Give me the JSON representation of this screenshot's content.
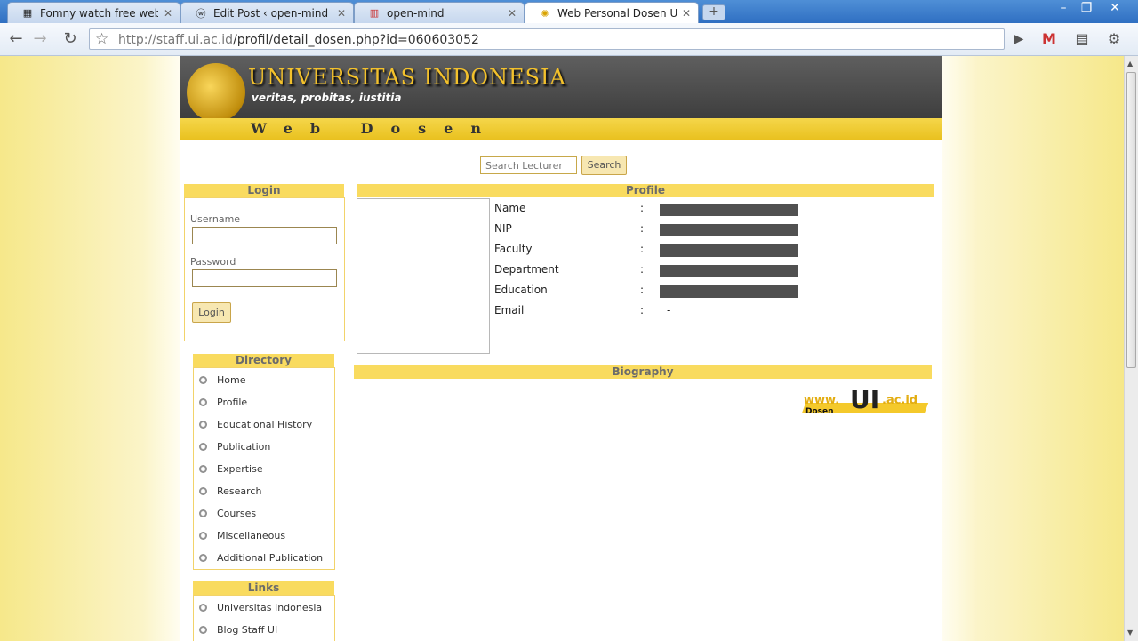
{
  "browser": {
    "tabs": [
      {
        "label": "Fomny watch free web T...",
        "icon": "calendar-favicon"
      },
      {
        "label": "Edit Post ‹ open-mind — ...",
        "icon": "wordpress-favicon"
      },
      {
        "label": "open-mind",
        "icon": "blog-favicon"
      },
      {
        "label": "Web Personal Dosen Uni...",
        "icon": "ui-favicon"
      }
    ],
    "url_host": "http://staff.ui.ac.id",
    "url_path": "/profil/detail_dosen.php?id=060603052"
  },
  "header": {
    "title": "UNIVERSITAS INDONESIA",
    "motto": "veritas, probitas, iustitia",
    "strip": "Web Dosen"
  },
  "search": {
    "placeholder": "Search Lecturer",
    "button": "Search"
  },
  "login": {
    "title": "Login",
    "username_label": "Username",
    "password_label": "Password",
    "button": "Login"
  },
  "directory": {
    "title": "Directory",
    "items": [
      "Home",
      "Profile",
      "Educational History",
      "Publication",
      "Expertise",
      "Research",
      "Courses",
      "Miscellaneous",
      "Additional Publication"
    ]
  },
  "links": {
    "title": "Links",
    "items": [
      "Universitas Indonesia",
      "Blog Staff UI"
    ]
  },
  "profile": {
    "title": "Profile",
    "fields": [
      {
        "label": "Name",
        "value": "",
        "redacted": true
      },
      {
        "label": "NIP",
        "value": "",
        "redacted": true
      },
      {
        "label": "Faculty",
        "value": "",
        "redacted": true
      },
      {
        "label": "Department",
        "value": "",
        "redacted": true
      },
      {
        "label": "Education",
        "value": "",
        "redacted": true
      },
      {
        "label": "Email",
        "value": "-",
        "redacted": false
      }
    ],
    "separator": ":"
  },
  "biography": {
    "title": "Biography"
  },
  "logo": {
    "www": "www.",
    "big": "UI",
    "acid": ".ac.id",
    "dosen": "Dosen"
  }
}
